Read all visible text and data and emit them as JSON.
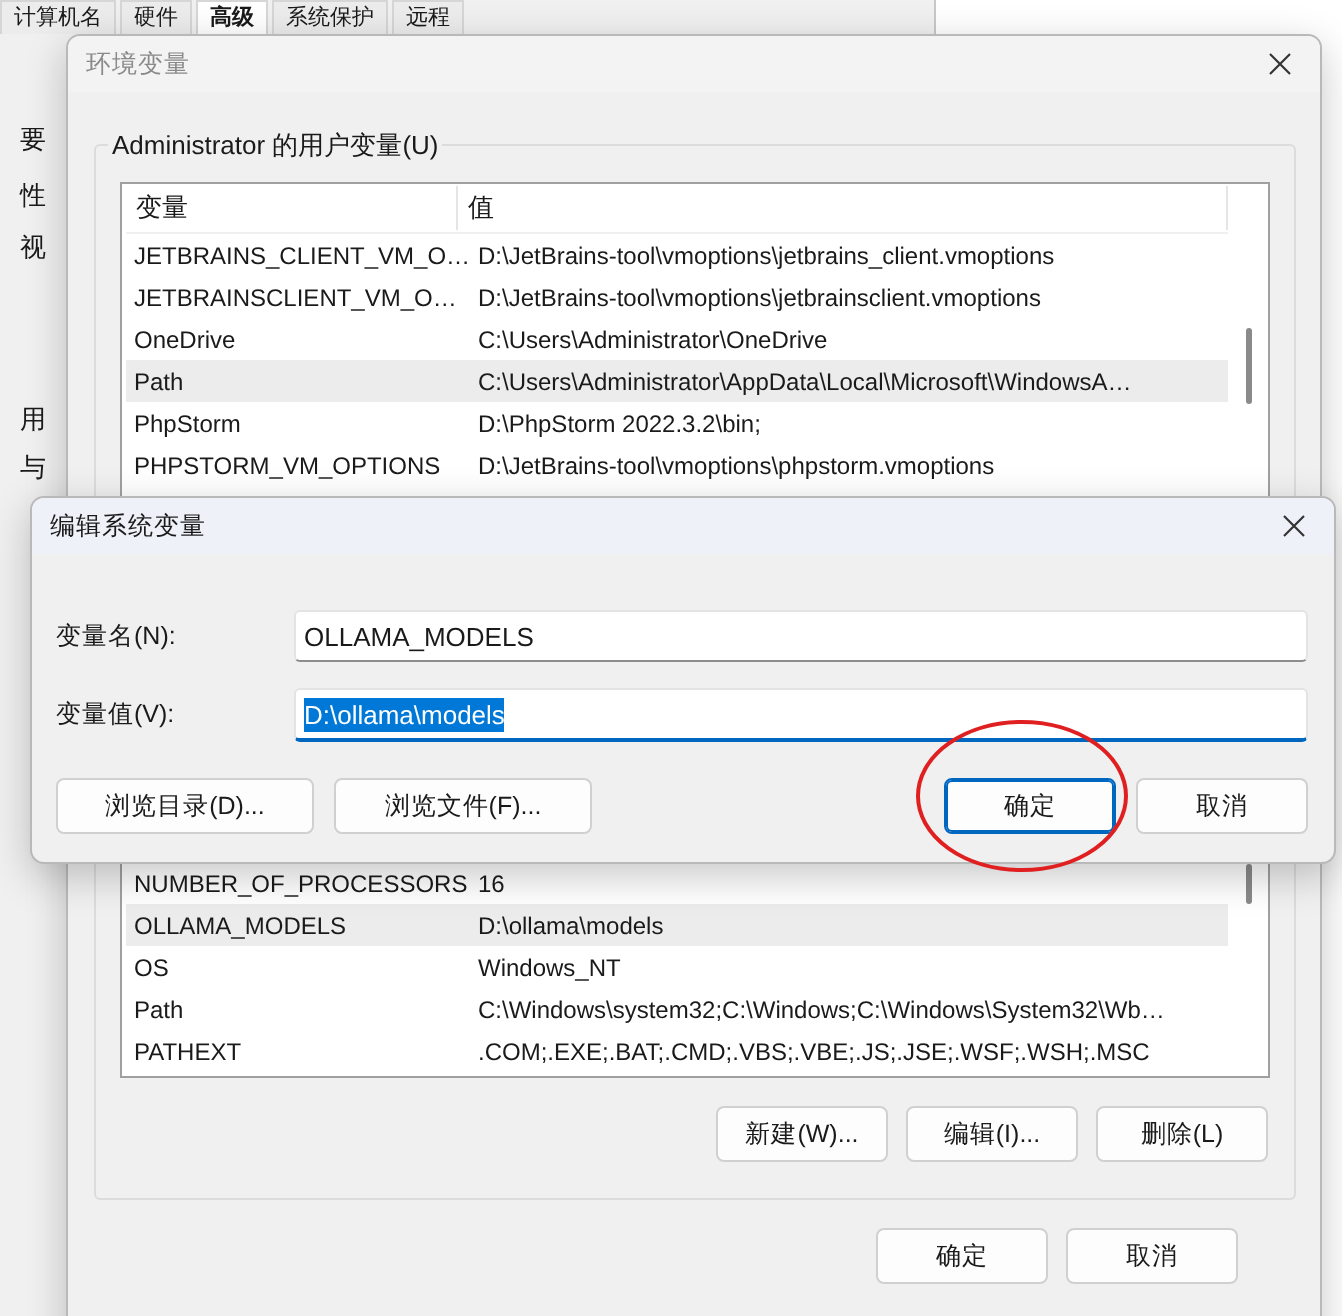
{
  "background_window": {
    "tabs": [
      {
        "label": "计算机名",
        "selected": false
      },
      {
        "label": "硬件",
        "selected": false
      },
      {
        "label": "高级",
        "selected": true
      },
      {
        "label": "系统保护",
        "selected": false
      },
      {
        "label": "远程",
        "selected": false
      }
    ],
    "fragments": [
      "要",
      "性",
      "视",
      "用",
      "与"
    ]
  },
  "env_dialog": {
    "title": "环境变量",
    "active": false,
    "user_group": {
      "label": "Administrator 的用户变量(U)",
      "columns": [
        "变量",
        "值"
      ],
      "rows": [
        {
          "name": "JETBRAINS_CLIENT_VM_O…",
          "value": "D:\\JetBrains-tool\\vmoptions\\jetbrains_client.vmoptions",
          "selected": false
        },
        {
          "name": "JETBRAINSCLIENT_VM_O…",
          "value": "D:\\JetBrains-tool\\vmoptions\\jetbrainsclient.vmoptions",
          "selected": false
        },
        {
          "name": "OneDrive",
          "value": "C:\\Users\\Administrator\\OneDrive",
          "selected": false
        },
        {
          "name": "Path",
          "value": "C:\\Users\\Administrator\\AppData\\Local\\Microsoft\\WindowsA…",
          "selected": true
        },
        {
          "name": "PhpStorm",
          "value": "D:\\PhpStorm 2022.3.2\\bin;",
          "selected": false
        },
        {
          "name": "PHPSTORM_VM_OPTIONS",
          "value": "D:\\JetBrains-tool\\vmoptions\\phpstorm.vmoptions",
          "selected": false
        }
      ]
    },
    "system_rows": [
      {
        "name": "NUMBER_OF_PROCESSORS",
        "value": "16",
        "selected": false
      },
      {
        "name": "OLLAMA_MODELS",
        "value": "D:\\ollama\\models",
        "selected": true
      },
      {
        "name": "OS",
        "value": "Windows_NT",
        "selected": false
      },
      {
        "name": "Path",
        "value": "C:\\Windows\\system32;C:\\Windows;C:\\Windows\\System32\\Wb…",
        "selected": false
      },
      {
        "name": "PATHEXT",
        "value": ".COM;.EXE;.BAT;.CMD;.VBS;.VBE;.JS;.JSE;.WSF;.WSH;.MSC",
        "selected": false
      }
    ],
    "system_buttons": [
      "新建(W)...",
      "编辑(I)...",
      "删除(L)"
    ],
    "buttons": [
      "确定",
      "取消"
    ]
  },
  "edit_dialog": {
    "title": "编辑系统变量",
    "active": true,
    "fields": [
      {
        "label": "变量名(N):",
        "value": "OLLAMA_MODELS",
        "focused": false
      },
      {
        "label": "变量值(V):",
        "value": "D:\\ollama\\models",
        "focused": true
      }
    ],
    "buttons": [
      {
        "label": "浏览目录(D)...",
        "kind": "browse"
      },
      {
        "label": "浏览文件(F)...",
        "kind": "browse"
      },
      {
        "label": "确定",
        "kind": "default"
      },
      {
        "label": "取消",
        "kind": "normal"
      }
    ]
  },
  "annotation": {
    "kind": "circle"
  }
}
